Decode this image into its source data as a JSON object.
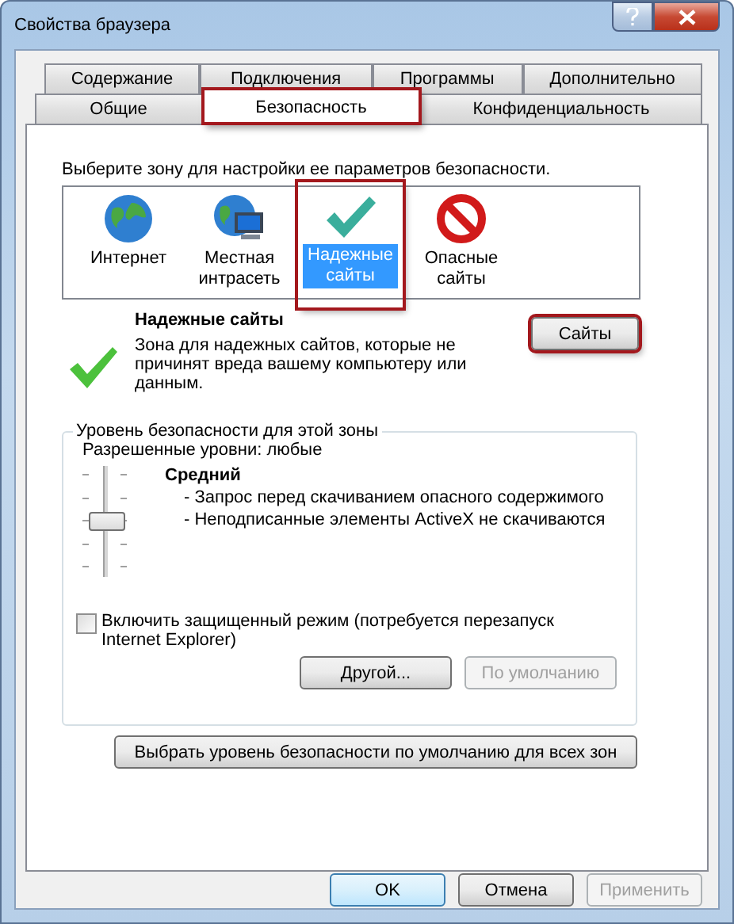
{
  "window": {
    "title": "Свойства браузера"
  },
  "tab_rows": [
    {
      "tabs": [
        {
          "label": "Содержание",
          "selected": false,
          "highlighted": false
        },
        {
          "label": "Подключения",
          "selected": false,
          "highlighted": false
        },
        {
          "label": "Программы",
          "selected": false,
          "highlighted": false
        },
        {
          "label": "Дополнительно",
          "selected": false,
          "highlighted": false
        }
      ]
    },
    {
      "tabs": [
        {
          "label": "Общие",
          "selected": false,
          "highlighted": false
        },
        {
          "label": "Безопасность",
          "selected": true,
          "highlighted": true
        },
        {
          "label": "Конфиденциальность",
          "selected": false,
          "highlighted": false
        }
      ]
    }
  ],
  "zone_prompt": "Выберите зону для настройки ее параметров безопасности.",
  "zones": [
    {
      "kind": "globe",
      "label": "Интернет",
      "selected": false,
      "highlighted": false
    },
    {
      "kind": "intranet",
      "label": "Местная интрасеть",
      "selected": false,
      "highlighted": false
    },
    {
      "kind": "trusted",
      "label": "Надежные сайты",
      "selected": true,
      "highlighted": true
    },
    {
      "kind": "blocked",
      "label": "Опасные сайты",
      "selected": false,
      "highlighted": false
    }
  ],
  "zone_info": {
    "title": "Надежные сайты",
    "description": "Зона для надежных сайтов, которые не причинят вреда вашему компьютеру или данным.",
    "sites_button": {
      "label": "Сайты",
      "highlighted": true
    }
  },
  "security_level": {
    "legend": "Уровень безопасности для этой зоны",
    "allowed": "Разрешенные уровни: любые",
    "slider": {
      "level": 0.5
    },
    "level_name": "Средний",
    "details": [
      "- Запрос перед скачиванием опасного содержимого",
      "- Неподписанные элементы ActiveX не скачиваются"
    ],
    "protected_mode": {
      "label": "Включить защищенный режим (потребуется перезапуск Internet Explorer)",
      "checked": false
    },
    "buttons": [
      {
        "label": "Другой...",
        "disabled": false
      },
      {
        "label": "По умолчанию",
        "disabled": true
      }
    ]
  },
  "reset_all_button": "Выбрать уровень безопасности по умолчанию для всех зон",
  "dialog_buttons": [
    {
      "label": "OK",
      "disabled": false,
      "default": true
    },
    {
      "label": "Отмена",
      "disabled": false,
      "default": false
    },
    {
      "label": "Применить",
      "disabled": true,
      "default": false
    }
  ]
}
